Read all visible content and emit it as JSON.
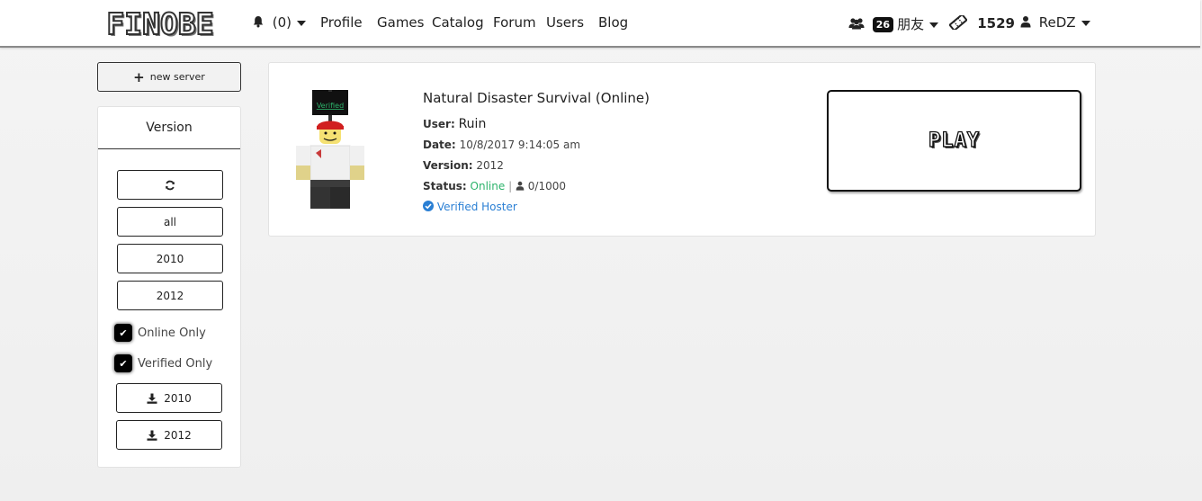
{
  "brand": {
    "logo": "FINOBE"
  },
  "nav": {
    "notifications": "(0)",
    "links": [
      "Profile",
      "Games",
      "Catalog",
      "Forum",
      "Users",
      "Blog"
    ],
    "friends_count": "26",
    "friends_label": "朋友",
    "currency": "1529",
    "username": "ReDZ"
  },
  "sidebar": {
    "new_server": "new server",
    "version_title": "Version",
    "filters": [
      "all",
      "2010",
      "2012"
    ],
    "online_only": "Online Only",
    "verified_only": "Verified Only",
    "downloads": [
      "2010",
      "2012"
    ]
  },
  "server": {
    "title": "Natural Disaster Survival (Online)",
    "user_label": "User:",
    "user": "Ruin",
    "date_label": "Date:",
    "date": "10/8/2017 9:14:05 am",
    "version_label": "Version:",
    "version": "2012",
    "status_label": "Status:",
    "status": "Online",
    "players": "0/1000",
    "verified": "Verified Hoster",
    "avatar_sign": "Verified",
    "play": "PLAY"
  },
  "colors": {
    "online": "#2db36b",
    "verified": "#2a7fd4"
  },
  "icons": [
    "bell-icon",
    "users-icon",
    "ticket-icon",
    "user-icon",
    "plus-icon",
    "refresh-icon",
    "check-icon",
    "download-icon",
    "check-circle-icon"
  ]
}
